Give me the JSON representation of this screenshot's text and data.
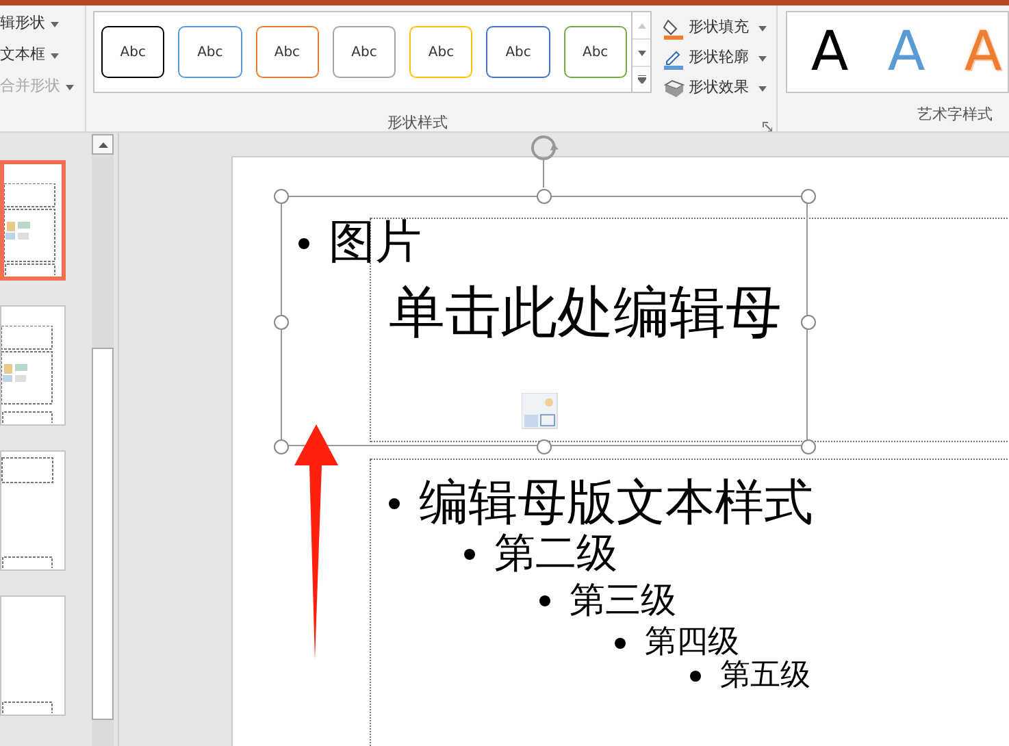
{
  "ribbon": {
    "left_commands": [
      {
        "label": "辑形状",
        "disabled": false
      },
      {
        "label": "文本框",
        "disabled": false
      },
      {
        "label": "合并形状",
        "disabled": true
      }
    ],
    "shape_styles": {
      "presets": [
        {
          "label": "Abc",
          "color": "#000000"
        },
        {
          "label": "Abc",
          "color": "#5b9bd5"
        },
        {
          "label": "Abc",
          "color": "#ed7d31"
        },
        {
          "label": "Abc",
          "color": "#a5a5a5"
        },
        {
          "label": "Abc",
          "color": "#ffc000"
        },
        {
          "label": "Abc",
          "color": "#4472c4"
        },
        {
          "label": "Abc",
          "color": "#70ad47"
        }
      ],
      "group_label": "形状样式"
    },
    "format_commands": [
      {
        "label": "形状填充",
        "kind": "fill"
      },
      {
        "label": "形状轮廓",
        "kind": "outline"
      },
      {
        "label": "形状效果",
        "kind": "effect"
      }
    ],
    "wordart_styles": {
      "presets": [
        {
          "label": "A",
          "kind": "fill",
          "color": "#000000"
        },
        {
          "label": "A",
          "kind": "fill",
          "color": "#5b9bd5"
        },
        {
          "label": "A",
          "kind": "outline",
          "color": "#ed7d31"
        }
      ],
      "group_label": "艺术字样式"
    }
  },
  "thumbnails": [
    {
      "kind": "content",
      "selected": true
    },
    {
      "kind": "content",
      "selected": false
    },
    {
      "kind": "title",
      "selected": false
    },
    {
      "kind": "blank",
      "selected": false
    }
  ],
  "slide": {
    "selected_box": {
      "text": "图片"
    },
    "title_placeholder": "单击此处编辑母",
    "body": [
      {
        "text": "编辑母版文本样式",
        "children": [
          {
            "text": "第二级",
            "children": [
              {
                "text": "第三级",
                "children": [
                  {
                    "text": "第四级",
                    "children": [
                      {
                        "text": "第五级"
                      }
                    ]
                  }
                ]
              }
            ]
          }
        ]
      }
    ]
  }
}
